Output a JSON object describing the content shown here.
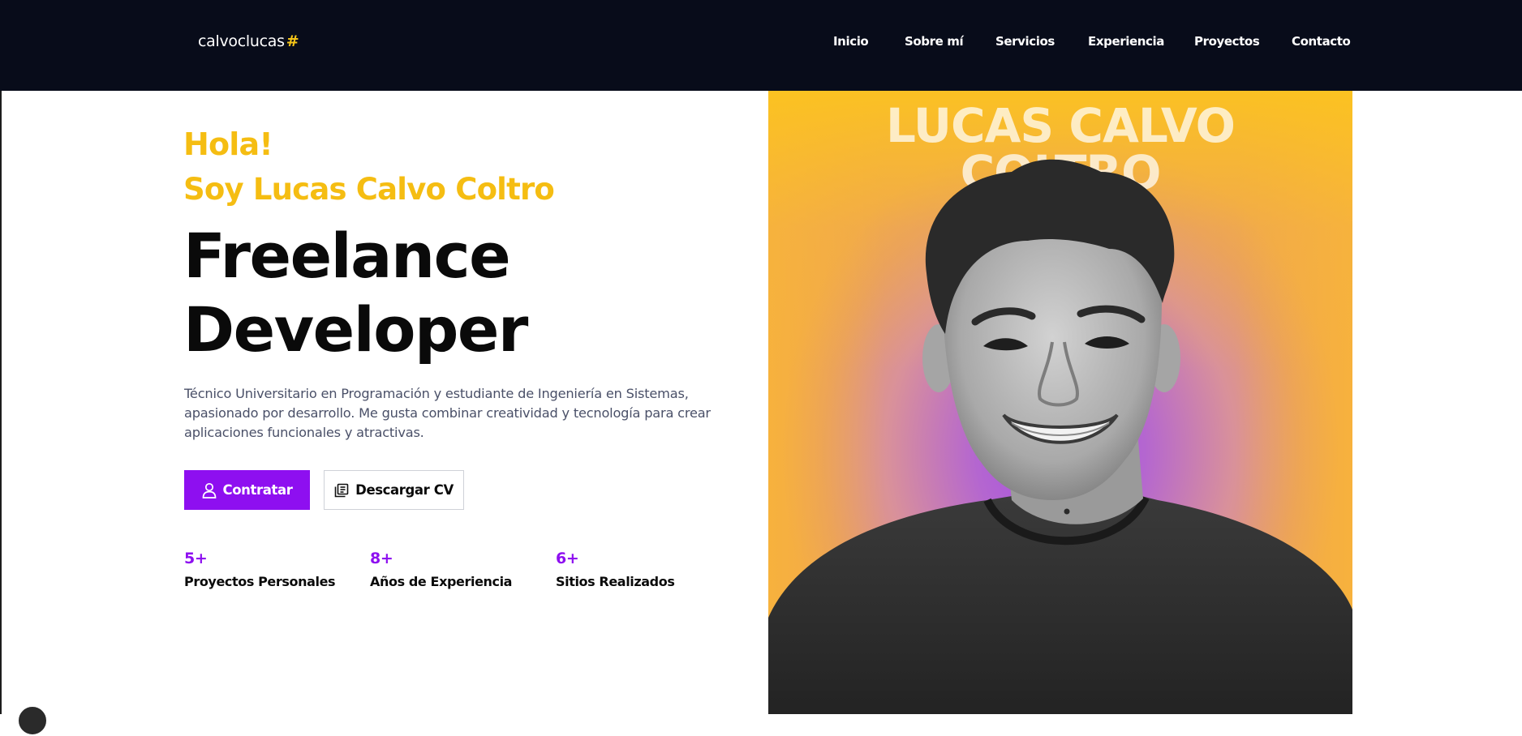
{
  "header": {
    "logo_text": "calvoclucas",
    "logo_symbol": "#",
    "nav": [
      "Inicio",
      "Sobre mí",
      "Servicios",
      "Experiencia",
      "Proyectos",
      "Contacto"
    ]
  },
  "hero": {
    "greeting_line1": "Hola!",
    "greeting_line2": "Soy Lucas Calvo Coltro",
    "headline_line1": "Freelance",
    "headline_line2": "Developer",
    "description": "Técnico Universitario en Programación y estudiante de Ingeniería en Sistemas, apasionado por desarrollo. Me gusta combinar creatividad y tecnología para crear aplicaciones funcionales y atractivas.",
    "primary_button": "Contratar",
    "secondary_button": "Descargar CV",
    "stats": [
      {
        "value": "5+",
        "label": "Proyectos Personales"
      },
      {
        "value": "8+",
        "label": "Años de Experiencia"
      },
      {
        "value": "6+",
        "label": "Sitios Realizados"
      }
    ],
    "photo_title_line1": "LUCAS CALVO",
    "photo_title_line2": "COLTRO"
  },
  "icons": {
    "primary_button_icon": "user-icon",
    "secondary_button_icon": "document-icon"
  },
  "colors": {
    "header_bg": "#080c1a",
    "accent_yellow": "#f5bd12",
    "accent_purple": "#8e0ff0",
    "text_dark": "#0a0a0a",
    "text_muted": "#4a5068"
  }
}
